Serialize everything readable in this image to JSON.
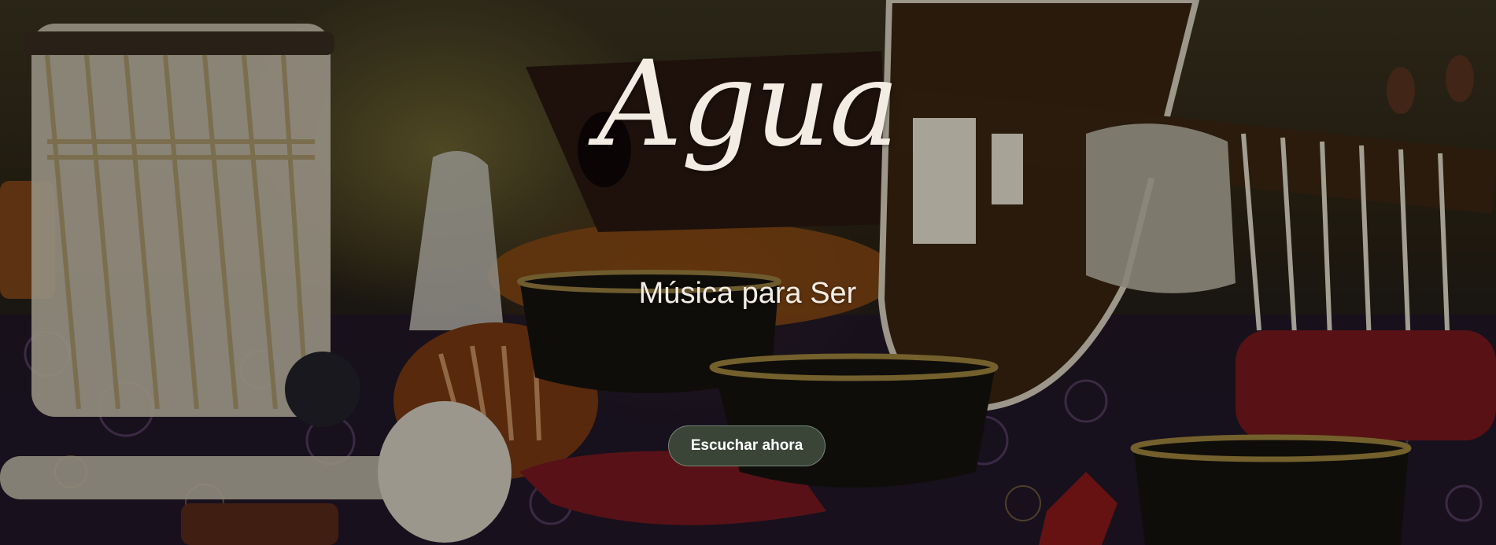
{
  "hero": {
    "title": "Agua",
    "subtitle": "Música para Ser",
    "cta_label": "Escuchar ahora",
    "background_image": "musical-instruments-photo"
  },
  "colors": {
    "text": "#f3ece3",
    "button_bg": "#3a4537",
    "button_border": "#aabeaa"
  }
}
